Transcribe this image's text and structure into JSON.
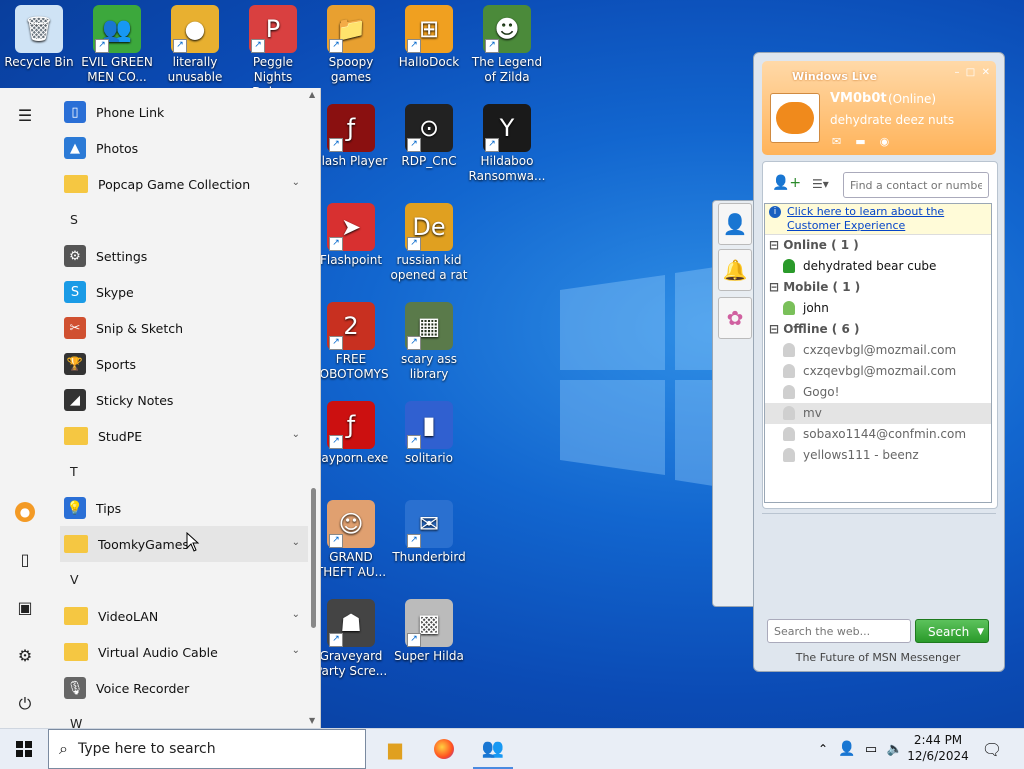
{
  "desktop_icons": [
    {
      "label": "Recycle Bin",
      "glyph": "🗑",
      "color": "#cfe3f5"
    },
    {
      "label": "EVIL GREEN MEN CO...",
      "glyph": "👥",
      "color": "#3ca83c"
    },
    {
      "label": "literally unusable",
      "glyph": "●",
      "color": "#e8b030"
    },
    {
      "label": "Peggle Nights Deluxe",
      "glyph": "P",
      "color": "#d94040"
    },
    {
      "label": "Spoopy games",
      "glyph": "📁",
      "color": "#e8a030"
    },
    {
      "label": "HalloDock",
      "glyph": "⊞",
      "color": "#f0a020"
    },
    {
      "label": "The Legend of Zilda",
      "glyph": "☻",
      "color": "#4b8a3a"
    },
    {
      "label": "Flash Player",
      "glyph": "ƒ",
      "color": "#8a1010"
    },
    {
      "label": "RDP_CnC",
      "glyph": "⊙",
      "color": "#222"
    },
    {
      "label": "Hildaboo Ransomwa...",
      "glyph": "Y",
      "color": "#1a1a1a"
    },
    {
      "label": "Flashpoint",
      "glyph": "➤",
      "color": "#d83030"
    },
    {
      "label": "russian kid opened a rat",
      "glyph": "De",
      "color": "#e0a020"
    },
    {
      "label": "FREE LOBOTOMYS",
      "glyph": "2",
      "color": "#c83020"
    },
    {
      "label": "scary ass library",
      "glyph": "▦",
      "color": "#5a7a4a"
    },
    {
      "label": "gayporn.exe",
      "glyph": "ƒ",
      "color": "#cc1010"
    },
    {
      "label": "solitario",
      "glyph": "▮",
      "color": "#3060d0"
    },
    {
      "label": "GRAND THEFT AU...",
      "glyph": "☺",
      "color": "#e0a070"
    },
    {
      "label": "Thunderbird",
      "glyph": "✉",
      "color": "#2a70d0"
    },
    {
      "label": "Graveyard Party Scre...",
      "glyph": "☗",
      "color": "#444"
    },
    {
      "label": "Super Hilda",
      "glyph": "▩",
      "color": "#bbb"
    }
  ],
  "start_menu": {
    "items": [
      {
        "type": "app",
        "label": "Phone Link",
        "glyph": "▯",
        "color": "#2a6fd6"
      },
      {
        "type": "app",
        "label": "Photos",
        "glyph": "▲",
        "color": "#2b7ad6"
      },
      {
        "type": "folder",
        "label": "Popcap Game Collection"
      },
      {
        "type": "letter",
        "label": "S"
      },
      {
        "type": "app",
        "label": "Settings",
        "glyph": "⚙",
        "color": "#555"
      },
      {
        "type": "app",
        "label": "Skype",
        "glyph": "S",
        "color": "#1a9be6"
      },
      {
        "type": "app",
        "label": "Snip & Sketch",
        "glyph": "✂",
        "color": "#d05030"
      },
      {
        "type": "app",
        "label": "Sports",
        "glyph": "🏆",
        "color": "#333"
      },
      {
        "type": "app",
        "label": "Sticky Notes",
        "glyph": "◢",
        "color": "#333"
      },
      {
        "type": "folder",
        "label": "StudPE"
      },
      {
        "type": "letter",
        "label": "T"
      },
      {
        "type": "app",
        "label": "Tips",
        "glyph": "💡",
        "color": "#2a6fd6"
      },
      {
        "type": "folder",
        "label": "ToomkyGames",
        "hover": true
      },
      {
        "type": "letter",
        "label": "V"
      },
      {
        "type": "folder",
        "label": "VideoLAN"
      },
      {
        "type": "folder",
        "label": "Virtual Audio Cable"
      },
      {
        "type": "app",
        "label": "Voice Recorder",
        "glyph": "🎙",
        "color": "#666"
      },
      {
        "type": "letter",
        "label": "W"
      }
    ]
  },
  "msn": {
    "title": "Windows Live",
    "username": "VM0b0t",
    "status": "(Online)",
    "personal_message": "dehydrate deez nuts",
    "search_contacts_placeholder": "Find a contact or number",
    "info_banner": "Click here to learn about the Customer Experience",
    "groups": [
      {
        "name": "Online ( 1 )",
        "contacts": [
          {
            "name": "dehydrated bear cube",
            "state": "online"
          }
        ]
      },
      {
        "name": "Mobile ( 1 )",
        "contacts": [
          {
            "name": "john",
            "state": "mobile"
          }
        ]
      },
      {
        "name": "Offline ( 6 )",
        "contacts": [
          {
            "name": "cxzqevbgl@mozmail.com",
            "state": "offline"
          },
          {
            "name": "cxzqevbgl@mozmail.com",
            "state": "offline"
          },
          {
            "name": "Gogo!",
            "state": "offline"
          },
          {
            "name": "mv",
            "state": "offline",
            "selected": true
          },
          {
            "name": "sobaxo1144@confmin.com",
            "state": "offline"
          },
          {
            "name": "yellows111 - beenz",
            "state": "offline"
          }
        ]
      }
    ],
    "web_search_placeholder": "Search the web...",
    "search_button": "Search",
    "footer": "The Future of MSN Messenger"
  },
  "taskbar": {
    "search_placeholder": "Type here to search",
    "time": "2:44 PM",
    "date": "12/6/2024"
  }
}
